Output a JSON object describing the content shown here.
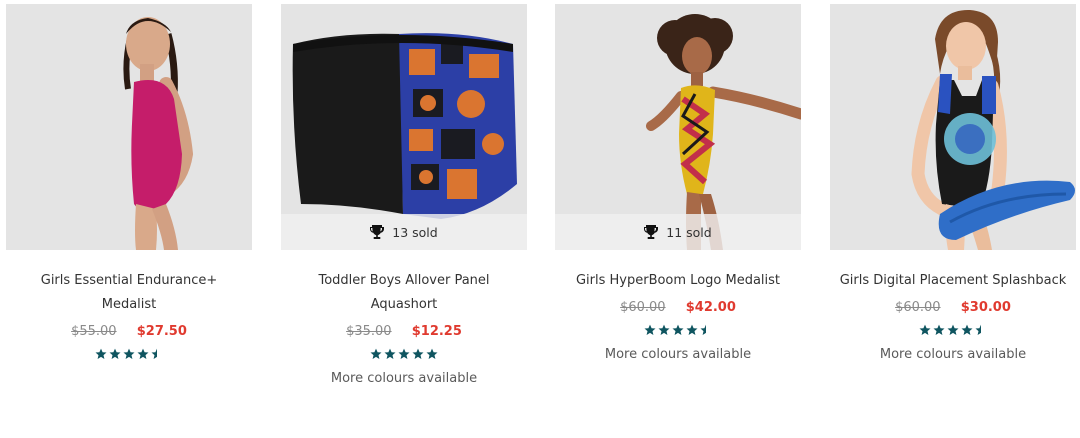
{
  "products": [
    {
      "name": "Girls Essential Endurance+ Medalist",
      "was_price": "$55.00",
      "now_price": "$27.50",
      "rating": 4.5,
      "sold": "",
      "more_colours": ""
    },
    {
      "name": "Toddler Boys Allover Panel Aquashort",
      "was_price": "$35.00",
      "now_price": "$12.25",
      "rating": 5,
      "sold": "13 sold",
      "more_colours": "More colours available"
    },
    {
      "name": "Girls HyperBoom Logo Medalist",
      "was_price": "$60.00",
      "now_price": "$42.00",
      "rating": 4.5,
      "sold": "11 sold",
      "more_colours": "More colours available"
    },
    {
      "name": "Girls Digital Placement Splashback",
      "was_price": "$60.00",
      "now_price": "$30.00",
      "rating": 4.5,
      "sold": "",
      "more_colours": "More colours available"
    }
  ],
  "colors": {
    "sale_price": "#e03a2f",
    "was_price": "#8a8a8a",
    "star": "#0f5560",
    "image_bg": "#e4e4e4"
  },
  "icons": {
    "sold_badge": "trophy-icon",
    "rating": "star-icon"
  }
}
